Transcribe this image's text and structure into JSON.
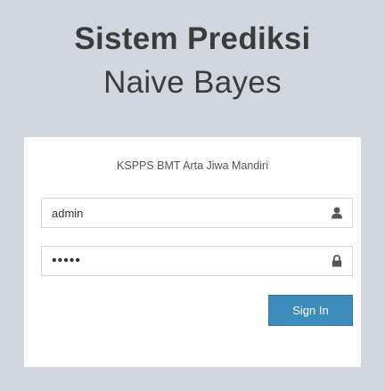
{
  "logo": {
    "line1": "Sistem Prediksi",
    "line2": "Naive Bayes"
  },
  "login": {
    "message": "KSPPS BMT Arta Jiwa Mandiri",
    "username_value": "admin",
    "password_value": "•••••",
    "username_icon": "user-icon",
    "password_icon": "lock-icon",
    "signin_label": "Sign In"
  },
  "colors": {
    "page_background": "#d2d6de",
    "button": "#3c8dbc",
    "text": "#3c3c3c"
  }
}
